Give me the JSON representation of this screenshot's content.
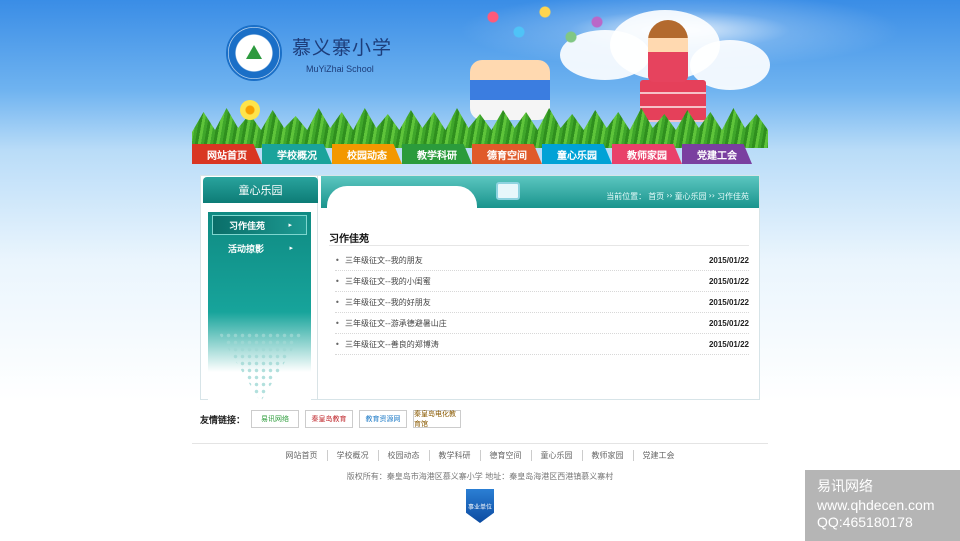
{
  "header": {
    "school_name_cn": "慕义寨小学",
    "school_name_en": "MuYiZhai School"
  },
  "nav": {
    "items": [
      {
        "label": "网站首页",
        "color": "#d93623"
      },
      {
        "label": "学校概况",
        "color": "#1aa39b"
      },
      {
        "label": "校园动态",
        "color": "#f39800"
      },
      {
        "label": "教学科研",
        "color": "#2b9b3c"
      },
      {
        "label": "德育空间",
        "color": "#e05a2a"
      },
      {
        "label": "童心乐园",
        "color": "#00a2d6"
      },
      {
        "label": "教师家园",
        "color": "#e9416a"
      },
      {
        "label": "党建工会",
        "color": "#7a3fa0"
      }
    ]
  },
  "sidebar": {
    "title": "童心乐园",
    "items": [
      {
        "label": "习作佳苑",
        "active": true
      },
      {
        "label": "活动掠影",
        "active": false
      }
    ],
    "arrow": "▸"
  },
  "breadcrumb": {
    "prefix": "当前位置：",
    "home": "首页",
    "sep1": "››",
    "section": "童心乐园",
    "sep2": "››",
    "current": "习作佳苑"
  },
  "content": {
    "section_title": "习作佳苑",
    "bullet": "•",
    "articles": [
      {
        "title": "三年级征文--我的朋友",
        "date": "2015/01/22"
      },
      {
        "title": "三年级征文--我的小闺蜜",
        "date": "2015/01/22"
      },
      {
        "title": "三年级征文--我的好朋友",
        "date": "2015/01/22"
      },
      {
        "title": "三年级征文--游承德避暑山庄",
        "date": "2015/01/22"
      },
      {
        "title": "三年级征文--善良的郑博涛",
        "date": "2015/01/22"
      }
    ]
  },
  "friend_links": {
    "label": "友情链接：",
    "items": [
      {
        "label": "易讯网络",
        "color": "#2c9c3a"
      },
      {
        "label": "秦皇岛教育",
        "color": "#c0282d"
      },
      {
        "label": "教育资源网",
        "color": "#1c7ac7"
      },
      {
        "label": "秦皇岛电化教育馆",
        "color": "#8a5a00"
      }
    ]
  },
  "footer": {
    "nav": [
      "网站首页",
      "学校概况",
      "校园动态",
      "教学科研",
      "德育空间",
      "童心乐园",
      "教师家园",
      "党建工会"
    ],
    "copyright": "版权所有：秦皇岛市海港区慕义寨小学  地址：秦皇岛海港区西港镇慕义寨村",
    "badge": "事业单位"
  },
  "watermark": {
    "line1": "易讯网络",
    "line2": "www.qhdecen.com",
    "line3": "QQ:465180178"
  }
}
